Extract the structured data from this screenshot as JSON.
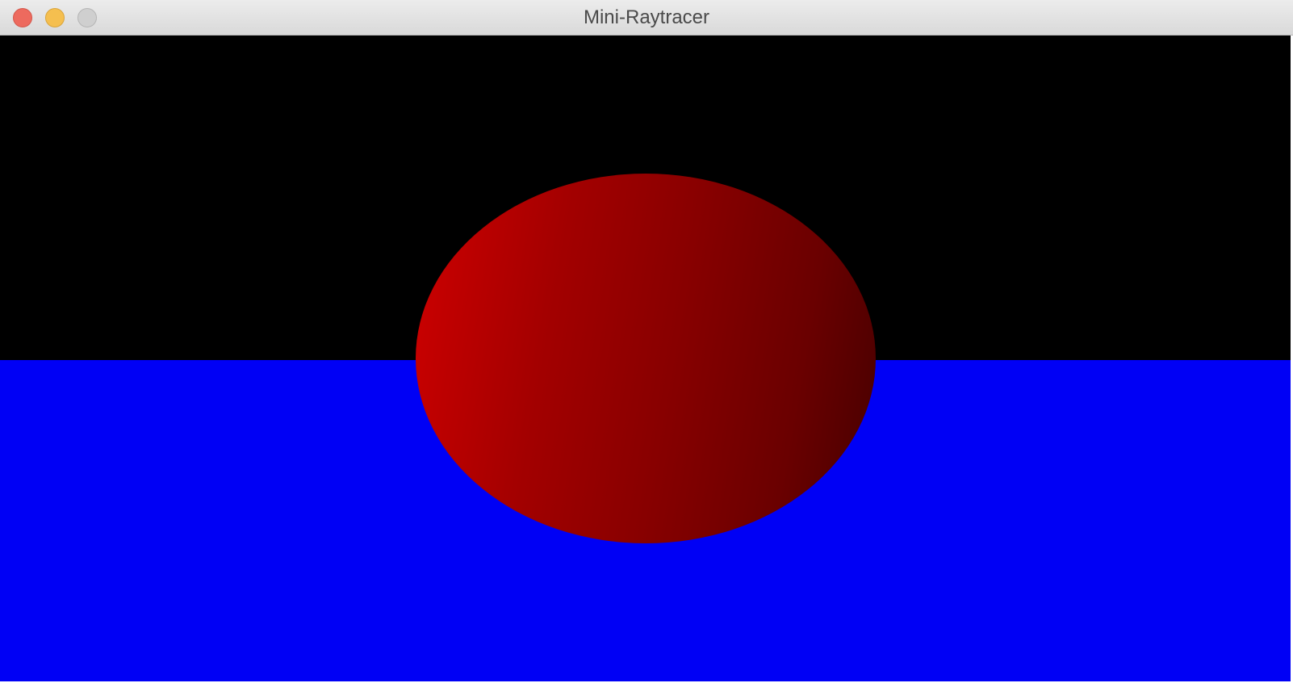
{
  "window": {
    "title": "Mini-Raytracer"
  },
  "scene": {
    "sky_color": "#000000",
    "floor_color": "#0000f5",
    "sphere_color": "#c80000",
    "sphere_shadow_color": "#450000"
  },
  "icons": {
    "close": "close-button-circle",
    "minimize": "minimize-button-circle",
    "zoom": "zoom-button-circle"
  }
}
